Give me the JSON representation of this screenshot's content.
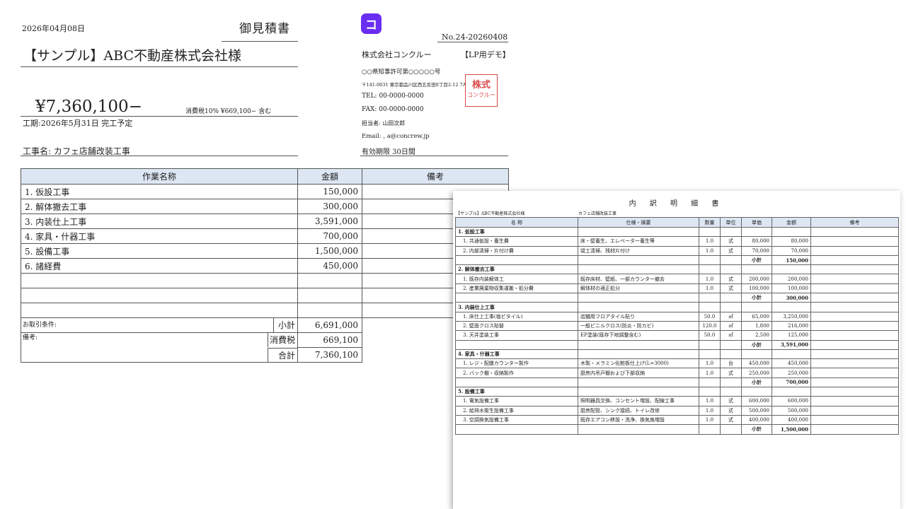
{
  "quote": {
    "date": "2026年04月08日",
    "title": "御見積書",
    "customer": "【サンプル】ABC不動産株式会社様",
    "total_display": "¥7,360,100−",
    "tax_note": "消費税10%  ¥669,100−  含む",
    "period": "工期:2026年5月31日 完工予定",
    "project": "工事名: カフェ店舗改装工事",
    "headers": {
      "work": "作業名称",
      "amount": "金額",
      "notes": "備考"
    },
    "items": [
      {
        "name": "1. 仮設工事",
        "amount": "150,000"
      },
      {
        "name": "2. 解体撤去工事",
        "amount": "300,000"
      },
      {
        "name": "3. 内装仕上工事",
        "amount": "3,591,000"
      },
      {
        "name": "4. 家具・什器工事",
        "amount": "700,000"
      },
      {
        "name": "5. 設備工事",
        "amount": "1,500,000"
      },
      {
        "name": "6. 諸経費",
        "amount": "450,000"
      }
    ],
    "terms_label": "お取引条件:",
    "notes_label": "備考:",
    "subtotal_label": "小計",
    "subtotal": "6,691,000",
    "tax_label": "消費税",
    "tax": "669,100",
    "grand_label": "合計",
    "grand": "7,360,100"
  },
  "company": {
    "logo_letter": "コ",
    "logo_color": "#6a2df2",
    "quote_no": "No.24-20260408",
    "name": "株式会社コンクルー",
    "tag": "【LP用デモ】",
    "license": "○○県知事許可第○○○○○号",
    "address": "〒141-0031 東京都品川区西五反田8丁目2-12 7A",
    "tel": "TEL: 00-0000-0000",
    "fax": "FAX: 00-0000-0000",
    "contact": "担当者: 山田次郎",
    "email": "Email: ,                       a@concrew.jp",
    "validity": "有効期限 30日間",
    "stamp_line1": "株式",
    "stamp_line2": "コンクルー",
    "stamp_color": "#d94a4a"
  },
  "detail": {
    "title": "内 訳 明 細 書",
    "customer": "【サンプル】ABC不動産株式会社様",
    "project": "カフェ店舗改装工事",
    "headers": {
      "name": "名  称",
      "spec": "仕様・摘要",
      "qty": "数量",
      "unit": "単位",
      "price": "単価",
      "amount": "金額",
      "notes": "備考"
    },
    "subtotal_label": "小計",
    "sections": [
      {
        "title": "1. 仮設工事",
        "rows": [
          {
            "name": "1. 共通仮設・養生費",
            "spec": "床・壁養生、エレベーター養生等",
            "qty": "1.0",
            "unit": "式",
            "price": "80,000",
            "amount": "80,000"
          },
          {
            "name": "2. 内部清掃・片付け費",
            "spec": "竣工清掃、残材片付け",
            "qty": "1.0",
            "unit": "式",
            "price": "70,000",
            "amount": "70,000"
          }
        ],
        "subtotal": "150,000"
      },
      {
        "title": "2. 解体撤去工事",
        "rows": [
          {
            "name": "1. 既存内装解体工",
            "spec": "既存床材、壁紙、一部カウンター撤去",
            "qty": "1.0",
            "unit": "式",
            "price": "200,000",
            "amount": "200,000"
          },
          {
            "name": "2. 産業廃棄物収集運搬・処分費",
            "spec": "解体材の適正処分",
            "qty": "1.0",
            "unit": "式",
            "price": "100,000",
            "amount": "100,000"
          }
        ],
        "subtotal": "300,000"
      },
      {
        "title": "3. 内装仕上工事",
        "rows": [
          {
            "name": "1. 床仕上工事(塩ビタイル)",
            "spec": "店舗用フロアタイル貼り",
            "qty": "50.0",
            "unit": "㎡",
            "price": "65,000",
            "amount": "3,250,000"
          },
          {
            "name": "2. 壁面クロス貼替",
            "spec": "一般ビニルクロス(防炎・防カビ)",
            "qty": "120.0",
            "unit": "㎡",
            "price": "1,800",
            "amount": "216,000"
          },
          {
            "name": "3. 天井塗装工事",
            "spec": "EP塗装(既存下地調整含む)",
            "qty": "50.0",
            "unit": "㎡",
            "price": "2,500",
            "amount": "125,000"
          }
        ],
        "subtotal": "3,591,000"
      },
      {
        "title": "4. 家具・什器工事",
        "rows": [
          {
            "name": "1. レジ・配膳カウンター製作",
            "spec": "木製・メラミン化粧板仕上げ(L=3000)",
            "qty": "1.0",
            "unit": "台",
            "price": "450,000",
            "amount": "450,000"
          },
          {
            "name": "2. バック棚・収納製作",
            "spec": "厨房内吊戸棚および下部収納",
            "qty": "1.0",
            "unit": "式",
            "price": "250,000",
            "amount": "250,000"
          }
        ],
        "subtotal": "700,000"
      },
      {
        "title": "5. 設備工事",
        "rows": [
          {
            "name": "1. 電気設備工事",
            "spec": "照明器具交換、コンセント増設、配線工事",
            "qty": "1.0",
            "unit": "式",
            "price": "600,000",
            "amount": "600,000"
          },
          {
            "name": "2. 給排水衛生設備工事",
            "spec": "厨房配管、シンク接続、トイレ改修",
            "qty": "1.0",
            "unit": "式",
            "price": "500,000",
            "amount": "500,000"
          },
          {
            "name": "3. 空調換気設備工事",
            "spec": "既存エアコン移設・洗浄、換気扇増設",
            "qty": "1.0",
            "unit": "式",
            "price": "400,000",
            "amount": "400,000"
          }
        ],
        "subtotal": "1,500,000"
      }
    ]
  }
}
